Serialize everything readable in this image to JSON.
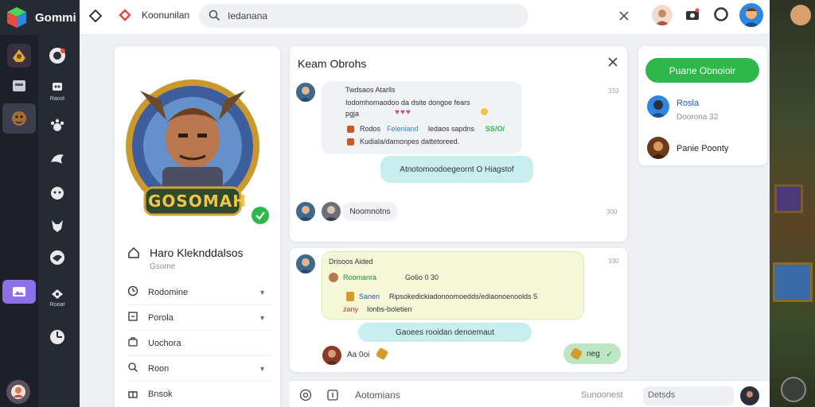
{
  "app": {
    "title": "Gommi",
    "brand_colors": {
      "green": "#2fb84a",
      "red": "#e74c3c",
      "blue": "#2e86de"
    }
  },
  "topbar": {
    "app_name": "Koonunilan",
    "search_value": "Iedanana",
    "icons": [
      "diamond-icon",
      "search-icon",
      "clear-icon",
      "avatar",
      "camera-icon",
      "record-icon",
      "user-avatar"
    ]
  },
  "rail": {
    "games": [
      {
        "icon": "helmet-game-icon"
      },
      {
        "icon": "monster-game-icon"
      },
      {
        "icon": "goblin-game-icon"
      },
      {
        "icon": "photo-game-icon"
      },
      {
        "icon": "profile-game-icon"
      }
    ],
    "tools": [
      {
        "icon": "lion-icon",
        "label": ""
      },
      {
        "icon": "robot-icon",
        "label": "Raost"
      },
      {
        "icon": "paw-icon",
        "label": ""
      },
      {
        "icon": "dragon-icon",
        "label": ""
      },
      {
        "icon": "cat-icon",
        "label": ""
      },
      {
        "icon": "wolf-icon",
        "label": ""
      },
      {
        "icon": "eagle-icon",
        "label": ""
      },
      {
        "icon": "bird-icon",
        "label": "Rooat"
      },
      {
        "icon": "clock-icon",
        "label": ""
      }
    ]
  },
  "profile": {
    "logo_text": "GOSOMAH",
    "name": "Haro Kleknddalsos",
    "subtitle": "Gsome",
    "menu": [
      {
        "icon": "clock-icon",
        "label": "Rodomine",
        "chevron": true
      },
      {
        "icon": "flag-icon",
        "label": "Porola",
        "chevron": true
      },
      {
        "icon": "briefcase-icon",
        "label": "Uochora",
        "chevron": false
      },
      {
        "icon": "search-icon",
        "label": "Roon",
        "chevron": true
      },
      {
        "icon": "gift-icon",
        "label": "Bnsok",
        "chevron": false
      }
    ]
  },
  "chat1": {
    "title": "Keam Obrohs",
    "messages": [
      {
        "author": "Twdsaos Atarlls",
        "line1": "Iodomhomaodoo da dsite dongoe fears",
        "line2": "pgja",
        "line3_a": "Rodos",
        "line3_b": "Feleniand",
        "line3_c": "ledaos sapdns",
        "line3_d": "SS/O/",
        "line4": "Kudiala/damonpes dattetoreed.",
        "time": "333"
      }
    ],
    "reply": "Atnotomoodoegeornt O Hiagstof",
    "note": "Noomnotns",
    "note_time": "300"
  },
  "chat2": {
    "author": "Drisoos Aided",
    "line1_a": "Roomanra",
    "line1_b": "Go6o 0 30",
    "line2_a": "Sanen",
    "line2_b": "Ripsokedickiadonoomoedds/ediaonoenoolds 5",
    "line3_a": "zany",
    "line3_b": "Ionbs-boletien",
    "time": "330",
    "reply": "Gaoees rooidan denoemaut",
    "footer_text": "Aa 0oi",
    "action": "neg"
  },
  "side": {
    "button": "Puane Obnoioir",
    "users": [
      {
        "name": "Rosla",
        "sub": "Doorona 32"
      },
      {
        "name": "Panie Poonty",
        "sub": ""
      }
    ]
  },
  "input": {
    "placeholder": "Aotomians",
    "status": "Sunoonest",
    "details": "Detsds"
  }
}
